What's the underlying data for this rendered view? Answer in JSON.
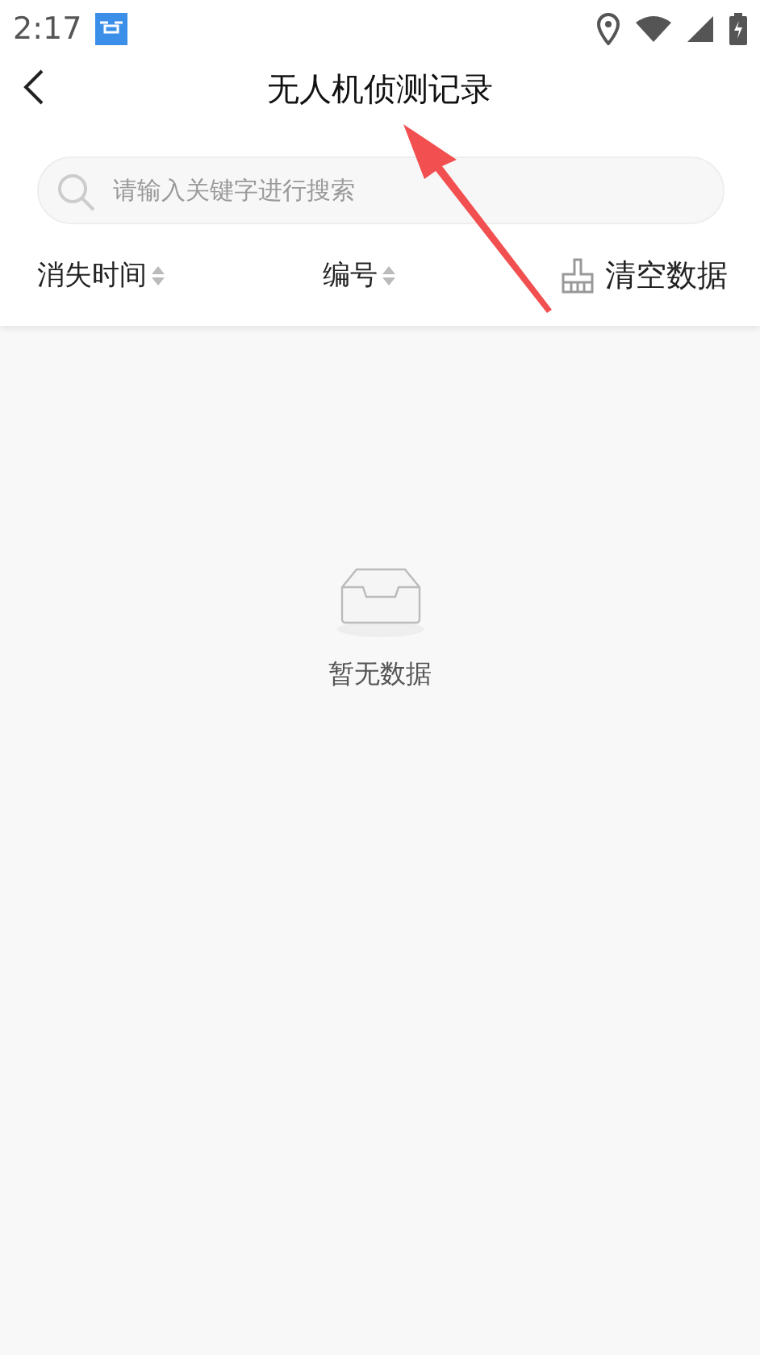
{
  "status_bar": {
    "time": "2:17"
  },
  "header": {
    "title": "无人机侦测记录"
  },
  "search": {
    "placeholder": "请输入关键字进行搜索"
  },
  "sort_columns": [
    {
      "label": "消失时间"
    },
    {
      "label": "编号"
    }
  ],
  "clear_button": {
    "label": "清空数据"
  },
  "empty_state": {
    "message": "暂无数据"
  }
}
